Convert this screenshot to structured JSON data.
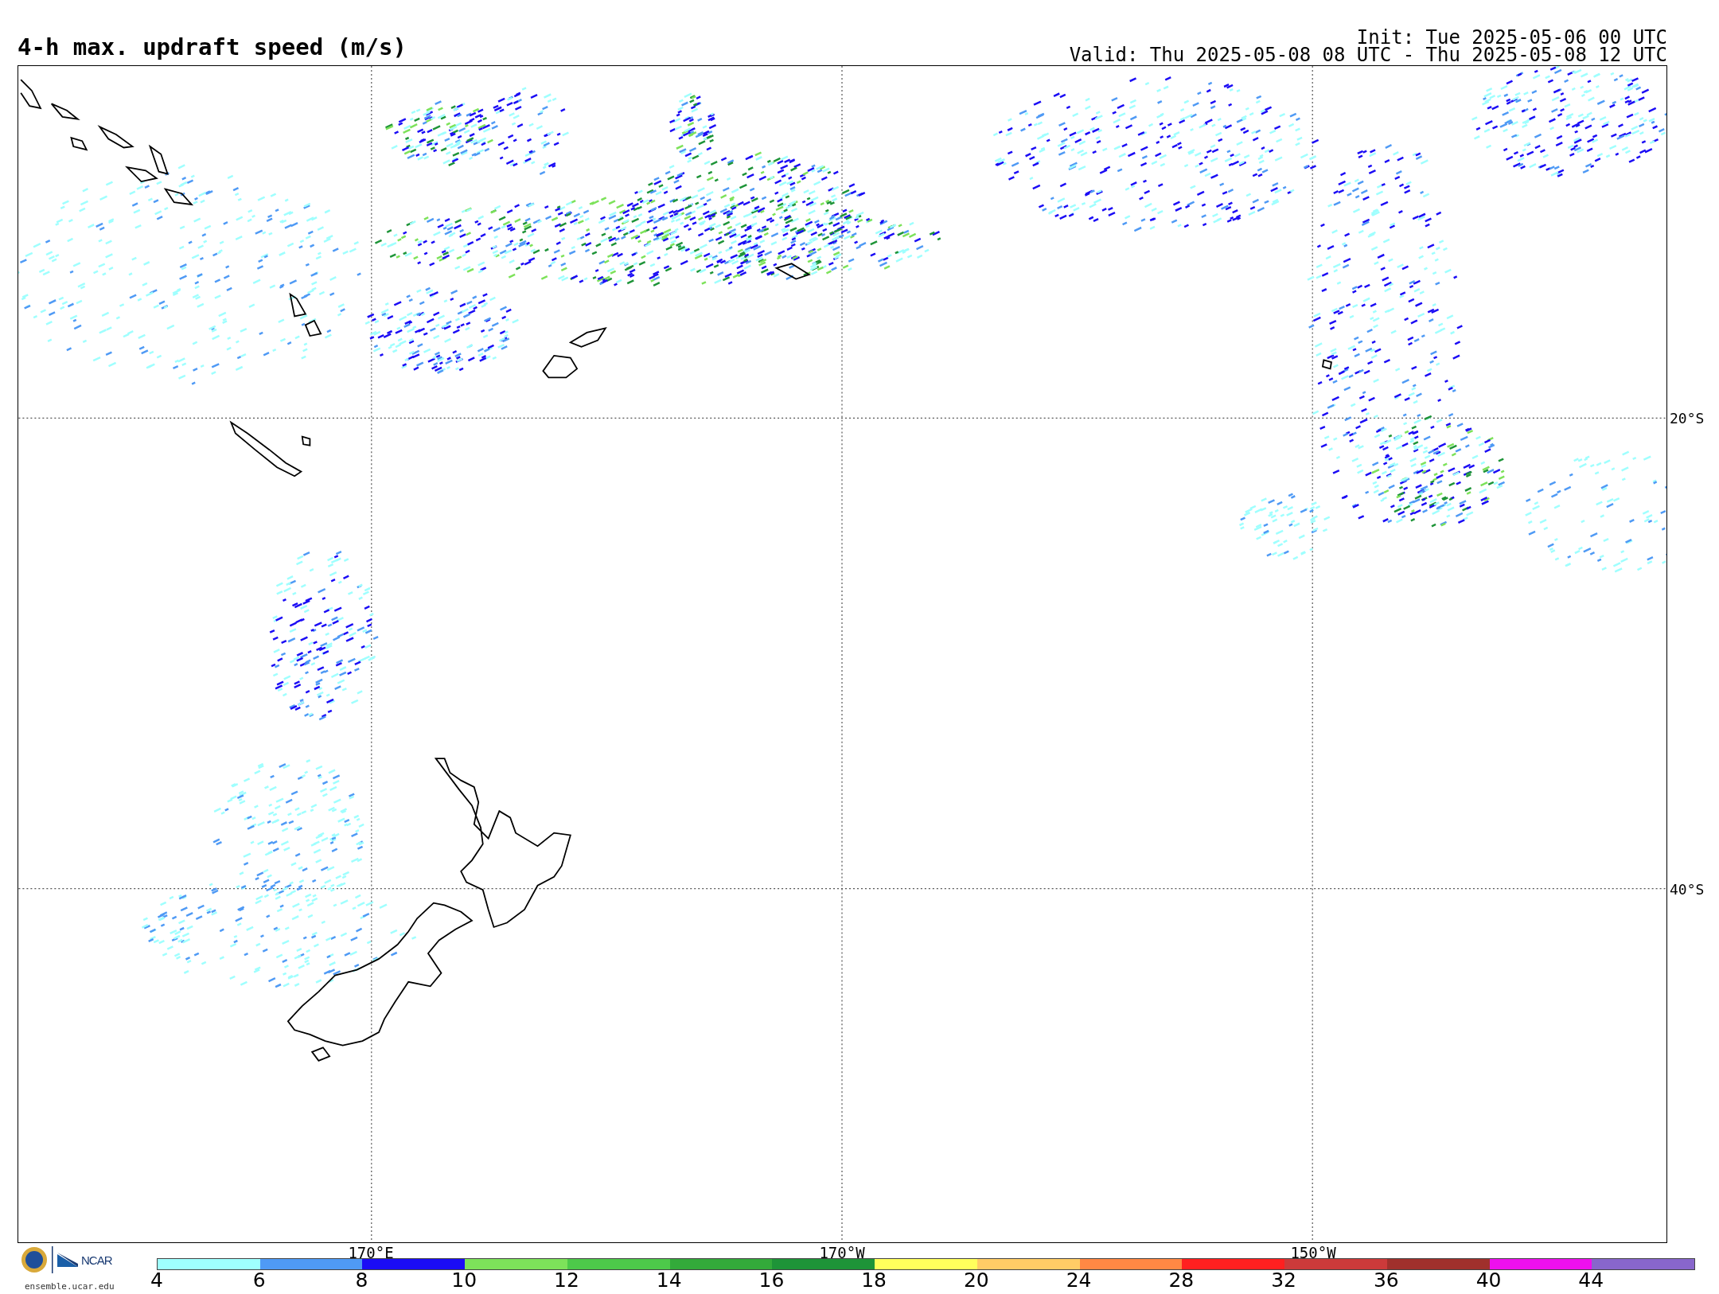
{
  "title": "4-h max. updraft speed (m/s)",
  "init": "Init: Tue 2025-05-06 00 UTC",
  "valid": "Valid: Thu 2025-05-08 08 UTC - Thu 2025-05-08 12 UTC",
  "lat_labels": [
    "20°S",
    "40°S"
  ],
  "lon_labels": [
    "170°E",
    "170°W",
    "150°W"
  ],
  "logo": {
    "name": "NCAR",
    "site": "ensemble.ucar.edu"
  },
  "legend": {
    "ticks": [
      "4",
      "6",
      "8",
      "10",
      "12",
      "14",
      "16",
      "18",
      "20",
      "24",
      "28",
      "32",
      "36",
      "40",
      "44"
    ],
    "bins": [
      {
        "color": "#9ffffe"
      },
      {
        "color": "#4f9af5"
      },
      {
        "color": "#1b0cf5"
      },
      {
        "color": "#7de25a"
      },
      {
        "color": "#4dc94a"
      },
      {
        "color": "#33aa3a"
      },
      {
        "color": "#1e9438"
      },
      {
        "color": "#ffff5c"
      },
      {
        "color": "#ffcc66"
      },
      {
        "color": "#ff8844"
      },
      {
        "color": "#ff2020"
      },
      {
        "color": "#cc3a3a"
      },
      {
        "color": "#a0302c"
      },
      {
        "color": "#ee10ee"
      },
      {
        "color": "#8866cc"
      }
    ]
  }
}
